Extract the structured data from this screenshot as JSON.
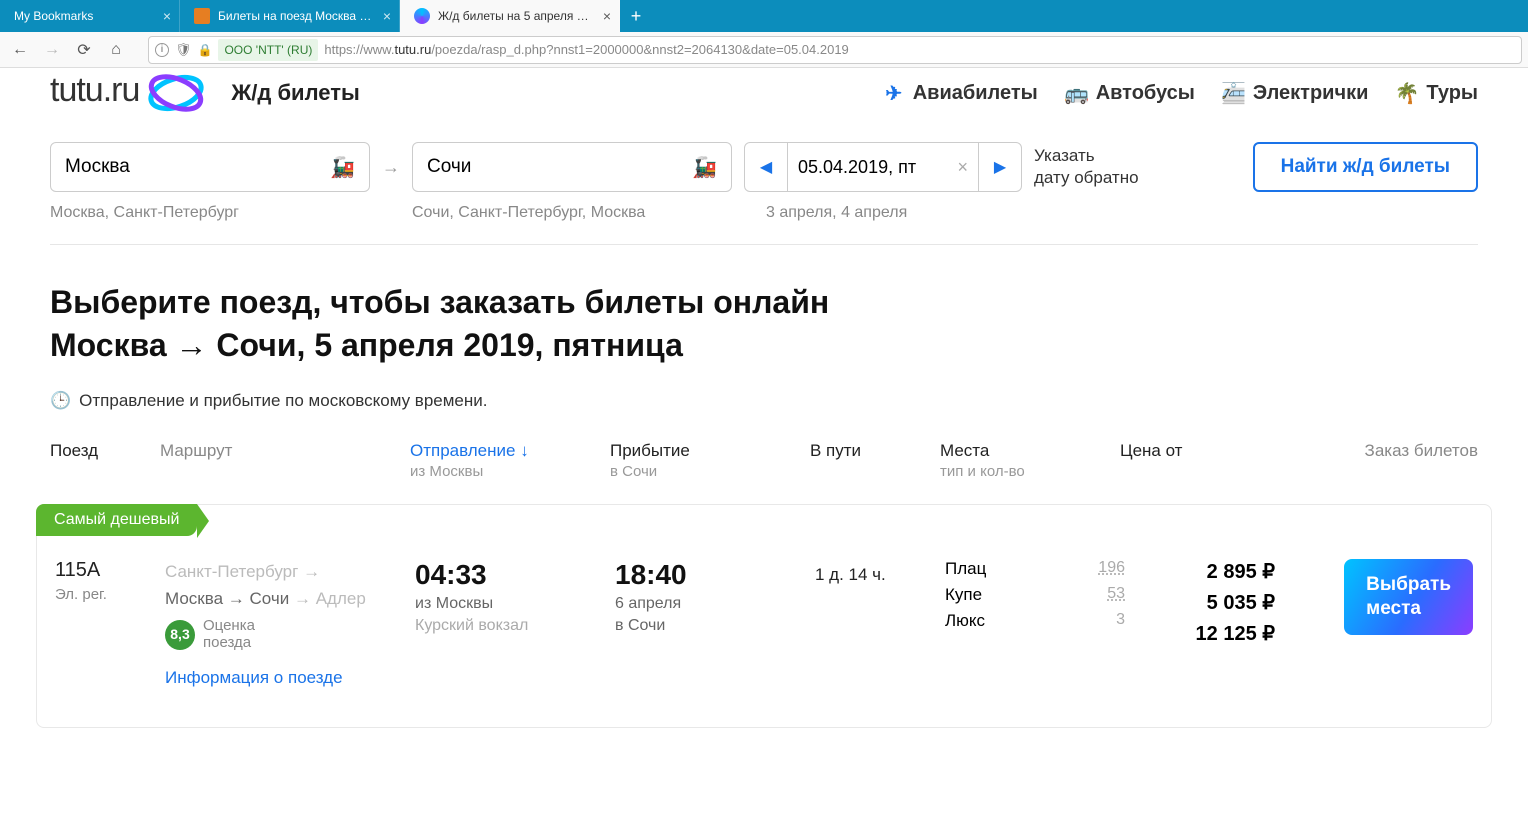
{
  "browser": {
    "tabs": [
      {
        "title": "My Bookmarks",
        "active": false
      },
      {
        "title": "Билеты на поезд Москва Бол…",
        "active": false
      },
      {
        "title": "Ж/д билеты на 5 апреля Мос…",
        "active": true
      }
    ],
    "url_cert": "OOO 'NTT' (RU)",
    "url_prefix": "https://www.",
    "url_host": "tutu.ru",
    "url_path": "/poezda/rasp_d.php?nnst1=2000000&nnst2=2064130&date=05.04.2019"
  },
  "header": {
    "logo": "tutu.ru",
    "section": "Ж/д билеты",
    "nav": {
      "avia": "Авиабилеты",
      "bus": "Автобусы",
      "elec": "Электрички",
      "tours": "Туры"
    }
  },
  "search": {
    "from": "Москва",
    "to": "Сочи",
    "date": "05.04.2019, пт",
    "return_hint_l1": "Указать",
    "return_hint_l2": "дату обратно",
    "find_btn": "Найти ж/д билеты",
    "suggest_from": "Москва, Санкт-Петербург",
    "suggest_to": "Сочи, Санкт-Петербург, Москва",
    "suggest_date": "3 апреля, 4 апреля"
  },
  "heading": {
    "l1": "Выберите поезд, чтобы заказать билеты онлайн",
    "l2": "Москва → Сочи, 5 апреля 2019, пятница",
    "tz": "Отправление и прибытие по московскому времени."
  },
  "cols": {
    "train": "Поезд",
    "route": "Маршрут",
    "dep": "Отправление",
    "dep_sub": "из Москвы",
    "arr": "Прибытие",
    "arr_sub": "в Сочи",
    "dur": "В пути",
    "seats": "Места",
    "seats_sub": "тип и кол-во",
    "price": "Цена от",
    "order": "Заказ билетов"
  },
  "badge_cheap": "Самый дешевый",
  "train": {
    "num": "115А",
    "reg": "Эл. рег.",
    "route": {
      "r1a": "Санкт-Петербург",
      "r2a": "Москва",
      "r2b": "Сочи",
      "r2c": "Адлер"
    },
    "rating": "8,3",
    "rating_label_l1": "Оценка",
    "rating_label_l2": "поезда",
    "info_link": "Информация о поезде",
    "dep_time": "04:33",
    "dep_sub1": "из Москвы",
    "dep_sub2": "Курский вокзал",
    "arr_time": "18:40",
    "arr_sub1": "6 апреля",
    "arr_sub2": "в Сочи",
    "duration": "1 д. 14 ч.",
    "seats": {
      "plats": "Плац",
      "plats_n": "196",
      "kupe": "Купе",
      "kupe_n": "53",
      "lux": "Люкс",
      "lux_n": "3"
    },
    "prices": {
      "p1": "2 895 ₽",
      "p2": "5 035 ₽",
      "p3": "12 125 ₽"
    },
    "choose_l1": "Выбрать",
    "choose_l2": "места"
  }
}
